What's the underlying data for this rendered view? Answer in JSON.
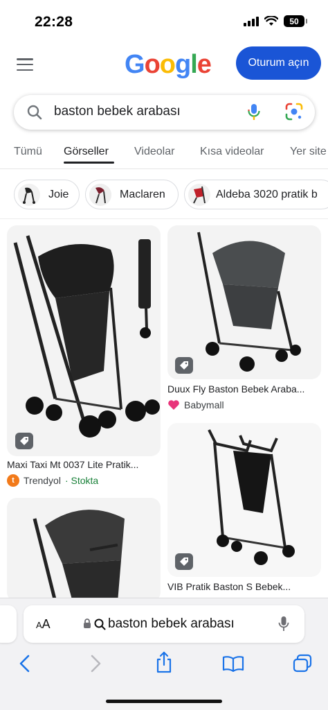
{
  "status": {
    "time": "22:28",
    "battery": "50"
  },
  "header": {
    "logo": [
      "G",
      "o",
      "o",
      "g",
      "l",
      "e"
    ],
    "signin_label": "Oturum açın"
  },
  "search": {
    "query": "baston bebek arabası"
  },
  "tabs": [
    {
      "label": "Tümü"
    },
    {
      "label": "Görseller",
      "active": true
    },
    {
      "label": "Videolar"
    },
    {
      "label": "Kısa videolar"
    },
    {
      "label": "Yer site"
    }
  ],
  "chips": [
    {
      "label": "Joie"
    },
    {
      "label": "Maclaren"
    },
    {
      "label": "Aldeba 3020 pratik b"
    }
  ],
  "results": [
    {
      "title": "Maxi Taxi Mt 0037 Lite Pratik...",
      "source": "Trendyol",
      "stock": "· Stokta"
    },
    {
      "title": "Duux Fly Baston Bebek Araba...",
      "source": "Babymall"
    },
    {
      "title": "VIB Pratik Baston S Bebek..."
    }
  ],
  "safari": {
    "aa_big": "A",
    "aa_small": "A",
    "url": "baston bebek arabası"
  },
  "colors": {
    "signin": "#1a55d6",
    "trendyol": "#f27a1a",
    "babymall": "#e8347a"
  }
}
